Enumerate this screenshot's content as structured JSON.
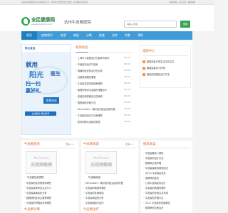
{
  "topbar": {
    "text": "用提供的健康医疗知识和资讯为主，不能作为诊断及治疗依据，有问题请咨询医生",
    "right": "收藏本站 | 设为首页 | 网站地图"
  },
  "header": {
    "logo_title": "全民健康网",
    "logo_url": "www.qmjk123.com",
    "site_name": "达州牛皮癣医院",
    "search_placeholder": "请输入内容",
    "search_button": "搜索"
  },
  "nav": [
    "首页",
    "疾病常识",
    "症状",
    "病因",
    "诊断",
    "检查",
    "治疗",
    "饮食",
    "预防"
  ],
  "ad": {
    "logo": "陈北星洁",
    "line1": "就用",
    "line2": "阳光",
    "line3": "医生",
    "line4": "扫一扫",
    "line5": "赢好礼",
    "tag": "免费咨询",
    "bottom": "在线咨询 预约挂号"
  },
  "news": {
    "title": "新闻动态",
    "items": [
      {
        "text": "上海什么医院治疗白癜风专家好",
        "date": "08-09"
      },
      {
        "text": "中医症状治疗牛皮癣",
        "date": "08-09"
      },
      {
        "text": "明确的症状的治疗的点评",
        "date": "08-09"
      },
      {
        "text": "白癜风病根在哪里",
        "date": "08-09"
      },
      {
        "text": "牛皮癣复发的原因有哪些",
        "date": "08-09"
      },
      {
        "text": "病理诊断对牛皮癣的重要意义",
        "date": "08-08"
      },
      {
        "text": "患者如何判断自己的病情",
        "date": "08-08"
      },
      {
        "text": "银屑病的诊断方法",
        "date": "08-08"
      },
      {
        "text": "Mel Autism - 确诊自闭症后该如何做",
        "date": "08-08"
      },
      {
        "text": "牛皮癣的治疗方法有哪些",
        "date": "08-08"
      },
      {
        "text": "如何判断牛皮癣的类型",
        "date": "08-08"
      }
    ]
  },
  "notice": {
    "title": "视频中心",
    "items": [
      {
        "num": "1",
        "text": "癫痫患者日常生活中应注意"
      },
      {
        "num": "2",
        "text": "癫痫患者怎么护理"
      },
      {
        "num": "3",
        "text": "痛经的原因及治疗方法"
      }
    ]
  },
  "nopic": {
    "en": "No Picture",
    "cn": "无视频截图"
  },
  "block_a": {
    "title": "牛皮癣症状",
    "caption": "牛皮癣如何预防",
    "items": [
      "牛皮癣的症状表现有哪些",
      "牛皮癣发病时应注意什么",
      "牛皮癣疾病症状分析",
      "银屑病的症状主要有哪些",
      "牛皮癣的早期症状有哪些",
      "牛皮癣患者应注意什么",
      "2011 牛皮癣的发病规律",
      "牛皮癣病因诊断"
    ]
  },
  "block_b": {
    "title": "牛皮癣病因",
    "caption": "牛皮癣病因",
    "items": [
      "Mel Autism - 确诊自闭症后该如何做",
      "牛皮癣的病因有哪些",
      "牛皮癣的发病原因",
      "牛皮癣病因的分析",
      "牛皮癣病因与遗传",
      "2011 牛皮癣的发病原因"
    ]
  },
  "recommend": {
    "title": "推荐阅读",
    "items": [
      "牛皮癣要怎么预防",
      "牛皮癣的治疗方法",
      "银屑病日常护理",
      "牛皮癣疾病的基础知识",
      "为什么牛皮癣会复发",
      "银屑病的症状",
      "儿童牛皮癣如何治疗",
      "牛皮癣的病因有哪些",
      "牛皮癣的饮食注意事项",
      "牛皮癣的护理方法",
      "2011 牛皮癣的发病原因",
      "银屑病的中医治疗"
    ]
  },
  "bottom_sections": {
    "left": "牛皮癣诊断",
    "mid": "牛皮癣治疗",
    "right": "牛皮癣治疗"
  },
  "more": "更多>>"
}
